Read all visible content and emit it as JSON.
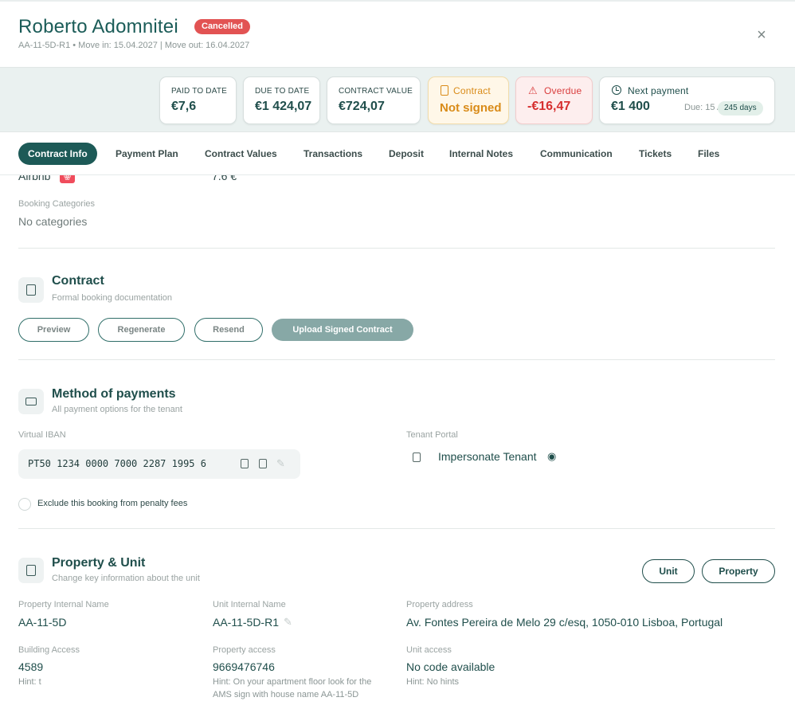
{
  "header": {
    "name": "Roberto Adomnitei",
    "status": "Cancelled",
    "subtitle": "AA-11-5D-R1 • Move in: 15.04.2027 | Move out: 16.04.2027",
    "close_icon": "×"
  },
  "stats": {
    "paid_label": "PAID TO DATE",
    "paid_value": "€7,6",
    "due_label": "DUE TO DATE",
    "due_value": "€1 424,07",
    "contract_value_label": "CONTRACT VALUE",
    "contract_value": "€724,07",
    "contract_label": "Contract",
    "contract_status": "Not signed",
    "overdue_label": "Overdue",
    "overdue_value": "-€16,47",
    "next_label": "Next payment",
    "next_value": "€1 400",
    "next_due": "Due: 15 Apr",
    "next_days": "245 days"
  },
  "tabs": [
    "Contract Info",
    "Payment Plan",
    "Contract Values",
    "Transactions",
    "Deposit",
    "Internal Notes",
    "Communication",
    "Tickets",
    "Files"
  ],
  "booking": {
    "source": "Airbnb",
    "amount": "7.6 €",
    "categories_label": "Booking Categories",
    "categories_value": "No categories"
  },
  "contract": {
    "title": "Contract",
    "subtitle": "Formal booking documentation",
    "preview": "Preview",
    "regenerate": "Regenerate",
    "resend": "Resend",
    "upload": "Upload Signed Contract"
  },
  "payments": {
    "title": "Method of payments",
    "subtitle": "All payment options for the tenant",
    "iban_label": "Virtual IBAN",
    "iban_value": "PT50 1234 0000 7000 2287 1995 6",
    "portal_label": "Tenant Portal",
    "impersonate": "Impersonate Tenant",
    "penalty_text": "Exclude this booking from penalty fees"
  },
  "property": {
    "title": "Property & Unit",
    "subtitle": "Change key information about the unit",
    "unit_btn": "Unit",
    "property_btn": "Property",
    "prop_name_label": "Property Internal Name",
    "prop_name_value": "AA-11-5D",
    "unit_name_label": "Unit Internal Name",
    "unit_name_value": "AA-11-5D-R1",
    "address_label": "Property address",
    "address_value": "Av. Fontes Pereira de Melo 29 c/esq, 1050-010 Lisboa, Portugal",
    "building_label": "Building Access",
    "building_value": "4589",
    "building_hint": "Hint: t",
    "prop_access_label": "Property access",
    "prop_access_value": "9669476746",
    "prop_access_hint": "Hint: On your apartment floor look for the AMS sign with house name AA-11-5D",
    "unit_access_label": "Unit access",
    "unit_access_value": "No code available",
    "unit_access_hint": "Hint: No hints"
  }
}
